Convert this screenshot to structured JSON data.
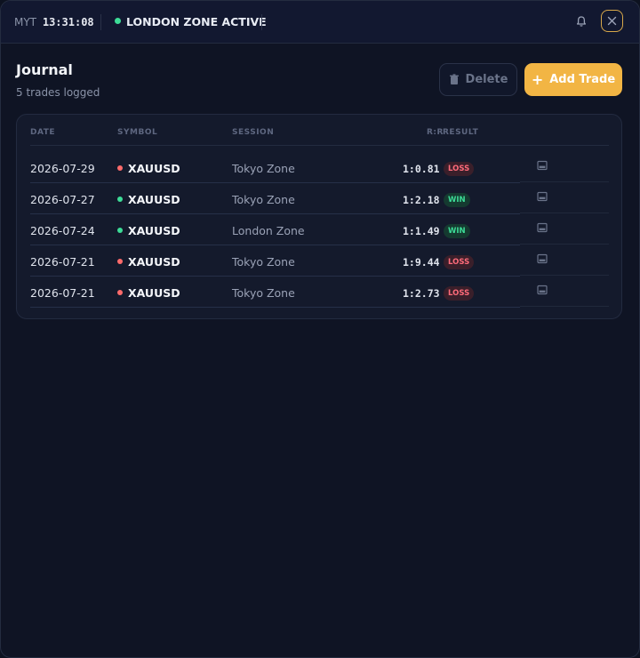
{
  "topbar": {
    "tz_label": "MYT",
    "time": "13:31:08",
    "zone_status": "LONDON ZONE ACTIVE",
    "zone_color": "#3ddc97"
  },
  "header": {
    "title": "Journal",
    "subtitle": "5 trades logged",
    "delete_label": "Delete",
    "add_label": "Add Trade",
    "add_plus": "+",
    "accent": "#f2b544"
  },
  "table": {
    "columns": {
      "date": "DATE",
      "symbol": "SYMBOL",
      "session": "SESSION",
      "rr": "R:R",
      "result": "RESULT"
    },
    "rows": [
      {
        "date": "2026-07-29",
        "symbol": "XAUUSD",
        "direction_color": "#ff6b6b",
        "session": "Tokyo Zone",
        "rr": "1:0.81",
        "result": "LOSS"
      },
      {
        "date": "2026-07-27",
        "symbol": "XAUUSD",
        "direction_color": "#3ddc97",
        "session": "Tokyo Zone",
        "rr": "1:2.18",
        "result": "WIN"
      },
      {
        "date": "2026-07-24",
        "symbol": "XAUUSD",
        "direction_color": "#3ddc97",
        "session": "London Zone",
        "rr": "1:1.49",
        "result": "WIN"
      },
      {
        "date": "2026-07-21",
        "symbol": "XAUUSD",
        "direction_color": "#ff6b6b",
        "session": "Tokyo Zone",
        "rr": "1:9.44",
        "result": "LOSS"
      },
      {
        "date": "2026-07-21",
        "symbol": "XAUUSD",
        "direction_color": "#ff6b6b",
        "session": "Tokyo Zone",
        "rr": "1:2.73",
        "result": "LOSS"
      }
    ]
  },
  "icons": {
    "bell": "bell-icon",
    "close": "close-icon",
    "delete": "trash-icon",
    "row_action": "image-icon"
  }
}
